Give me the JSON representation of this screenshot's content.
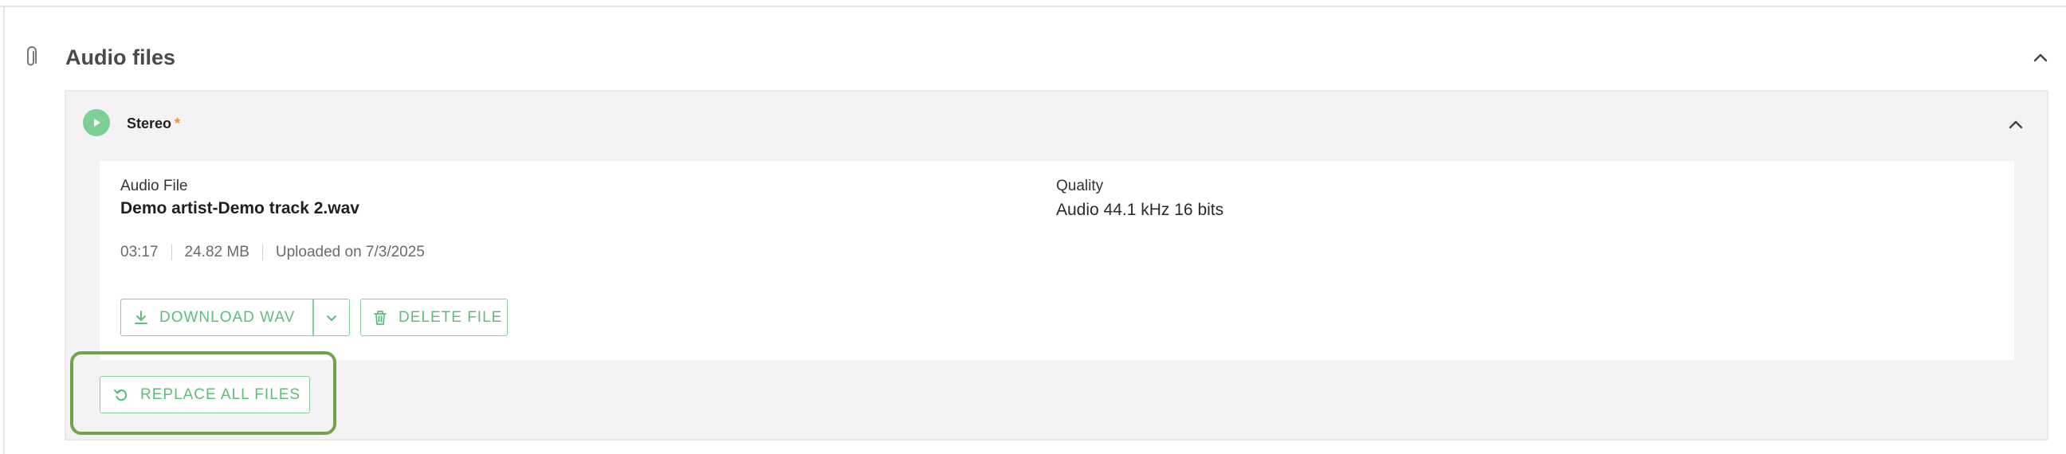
{
  "section": {
    "title": "Audio files",
    "icon": "paperclip-icon",
    "collapse_icon": "chevron-up-icon"
  },
  "panel": {
    "title": "Stereo",
    "required_mark": "*",
    "play_icon": "play-icon",
    "collapse_icon": "chevron-up-icon"
  },
  "file": {
    "audio_label": "Audio File",
    "file_name": "Demo artist-Demo track 2.wav",
    "quality_label": "Quality",
    "quality_value": "Audio 44.1 kHz 16 bits",
    "duration": "03:17",
    "size": "24.82 MB",
    "uploaded": "Uploaded on 7/3/2025"
  },
  "actions": {
    "download_label": "DOWNLOAD WAV",
    "delete_label": "DELETE FILE",
    "replace_label": "REPLACE ALL FILES"
  },
  "colors": {
    "accent_green": "#5fbd7b",
    "play_green": "#7ccf95",
    "highlight": "#6ea54b",
    "required": "#f08a30"
  }
}
